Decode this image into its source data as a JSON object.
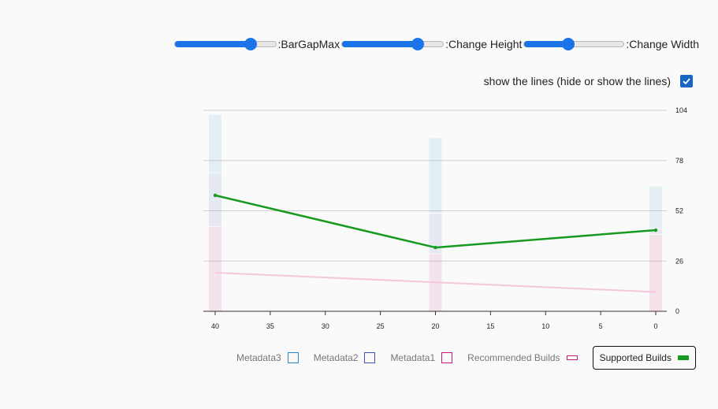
{
  "controls": {
    "sliders": [
      {
        "label": ":BarGapMax",
        "fraction": 0.75
      },
      {
        "label": ":Change Height",
        "fraction": 0.75
      },
      {
        "label": ":Change Width",
        "fraction": 0.44
      }
    ],
    "toggle": {
      "label": "show the lines (hide or show the lines)",
      "checked": true
    }
  },
  "chart_data": {
    "type": "bar",
    "x_ticks": [
      "40",
      "35",
      "30",
      "25",
      "20",
      "15",
      "10",
      "5",
      "0"
    ],
    "y_ticks": [
      "0",
      "26",
      "52",
      "78",
      "104"
    ],
    "ylim": [
      0,
      104
    ],
    "xlim": [
      40,
      0
    ],
    "grid": true,
    "legend_position": "bottom",
    "x": [
      40,
      20,
      0
    ],
    "series": [
      {
        "name": "Metadata1",
        "kind": "stacked-bar",
        "color": "#c2187a",
        "values": [
          44,
          30,
          40
        ]
      },
      {
        "name": "Metadata2",
        "kind": "stacked-bar",
        "color": "#3f51b5",
        "values": [
          28,
          21,
          3
        ]
      },
      {
        "name": "Metadata3",
        "kind": "stacked-bar",
        "color": "#2986cc",
        "values": [
          30,
          39,
          22
        ]
      },
      {
        "name": "Recommended Builds",
        "kind": "line",
        "color": "#f5c6dc",
        "values": [
          20,
          15,
          10
        ]
      },
      {
        "name": "Supported Builds",
        "kind": "line",
        "color": "#18991f",
        "values": [
          60,
          33,
          42
        ]
      }
    ],
    "legend": [
      {
        "label": "Metadata3",
        "color": "#2986cc",
        "shape": "square"
      },
      {
        "label": "Metadata2",
        "color": "#3f51b5",
        "shape": "square"
      },
      {
        "label": "Metadata1",
        "color": "#c2187a",
        "shape": "square"
      },
      {
        "label": "Recommended Builds",
        "color": "#c2187a",
        "shape": "line"
      },
      {
        "label": "Supported Builds",
        "color": "#18991f",
        "shape": "line",
        "active": true
      }
    ]
  }
}
